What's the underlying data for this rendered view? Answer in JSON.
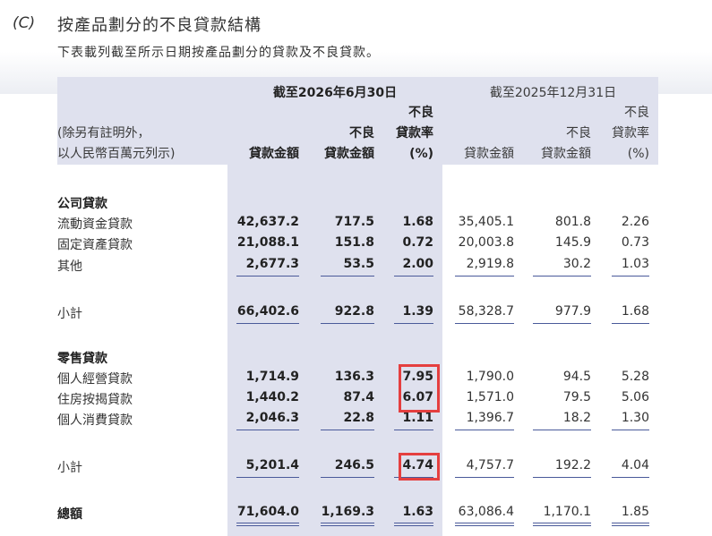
{
  "section": {
    "label": "(C)",
    "title": "按產品劃分的不良貸款結構",
    "intro": "下表載列截至所示日期按產品劃分的貸款及不良貸款。"
  },
  "header": {
    "period_current": "截至2026年6月30日",
    "period_prior": "截至2025年12月31日",
    "note_line1": "(除另有註明外，",
    "note_line2": "以人民幣百萬元列示)",
    "loan_amount": "貸款金額",
    "npl_line1": "不良",
    "npl_line2": "貸款金額",
    "ratio_line1": "不良",
    "ratio_line2": "貸款率",
    "ratio_line3": "(%)"
  },
  "rows": {
    "corp_heading": "公司貸款",
    "r1": {
      "label": "流動資金貸款",
      "c1": "42,637.2",
      "c2": "717.5",
      "c3": "1.68",
      "p1": "35,405.1",
      "p2": "801.8",
      "p3": "2.26"
    },
    "r2": {
      "label": "固定資產貸款",
      "c1": "21,088.1",
      "c2": "151.8",
      "c3": "0.72",
      "p1": "20,003.8",
      "p2": "145.9",
      "p3": "0.73"
    },
    "r3": {
      "label": "其他",
      "c1": "2,677.3",
      "c2": "53.5",
      "c3": "2.00",
      "p1": "2,919.8",
      "p2": "30.2",
      "p3": "1.03"
    },
    "s1": {
      "label": "小計",
      "c1": "66,402.6",
      "c2": "922.8",
      "c3": "1.39",
      "p1": "58,328.7",
      "p2": "977.9",
      "p3": "1.68"
    },
    "retail_heading": "零售貸款",
    "r4": {
      "label": "個人經營貸款",
      "c1": "1,714.9",
      "c2": "136.3",
      "c3": "7.95",
      "p1": "1,790.0",
      "p2": "94.5",
      "p3": "5.28"
    },
    "r5": {
      "label": "住房按揭貸款",
      "c1": "1,440.2",
      "c2": "87.4",
      "c3": "6.07",
      "p1": "1,571.0",
      "p2": "79.5",
      "p3": "5.06"
    },
    "r6": {
      "label": "個人消費貸款",
      "c1": "2,046.3",
      "c2": "22.8",
      "c3": "1.11",
      "p1": "1,396.7",
      "p2": "18.2",
      "p3": "1.30"
    },
    "s2": {
      "label": "小計",
      "c1": "5,201.4",
      "c2": "246.5",
      "c3": "4.74",
      "p1": "4,757.7",
      "p2": "192.2",
      "p3": "4.04"
    },
    "total": {
      "label": "總額",
      "c1": "71,604.0",
      "c2": "1,169.3",
      "c3": "1.63",
      "p1": "63,086.4",
      "p2": "1,170.1",
      "p3": "1.85"
    }
  },
  "colors": {
    "highlight": "#e53f3f",
    "shade": "#dfe1ee",
    "rule": "#4a5a9a"
  }
}
